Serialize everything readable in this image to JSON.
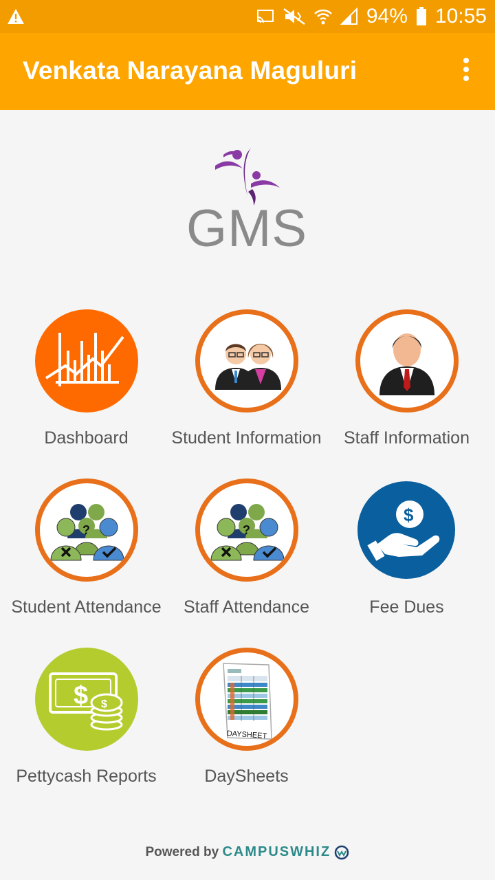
{
  "status": {
    "battery": "94%",
    "time": "10:55"
  },
  "app_bar": {
    "title": "Venkata Narayana Maguluri"
  },
  "logo": {
    "text": "GMS"
  },
  "menu": [
    {
      "label": "Dashboard",
      "icon": "dashboard-chart-icon"
    },
    {
      "label": "Student Information",
      "icon": "students-icon"
    },
    {
      "label": "Staff Information",
      "icon": "staff-icon"
    },
    {
      "label": "Student Attendance",
      "icon": "attendance-icon"
    },
    {
      "label": "Staff Attendance",
      "icon": "attendance-icon"
    },
    {
      "label": "Fee Dues",
      "icon": "fee-dues-icon"
    },
    {
      "label": "Pettycash Reports",
      "icon": "pettycash-icon"
    },
    {
      "label": "DaySheets",
      "icon": "daysheet-icon"
    }
  ],
  "daysheet_caption": "DAYSHEET",
  "footer": {
    "powered_by": "Powered by",
    "brand": "CAMPUSWHIZ"
  },
  "colors": {
    "status_bar": "#f39c00",
    "app_bar": "#ffa500",
    "accent_ring": "#e8701a",
    "background": "#f5f5f5"
  }
}
